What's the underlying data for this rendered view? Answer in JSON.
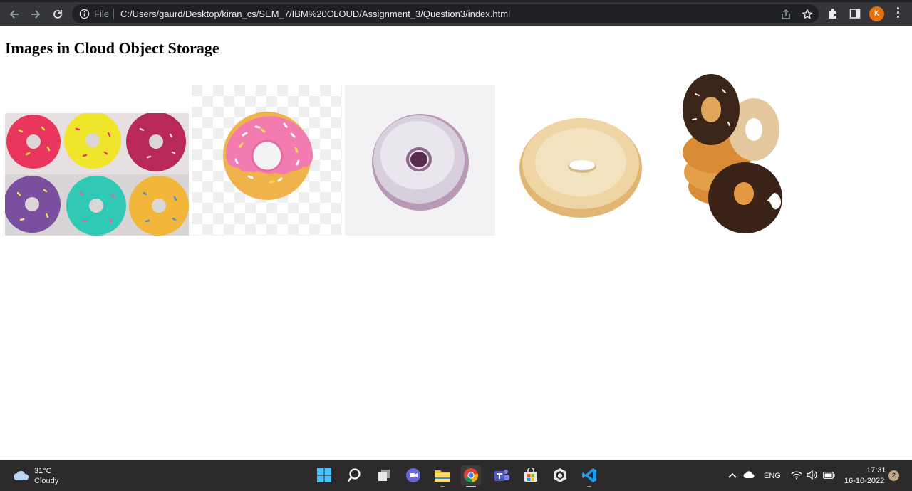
{
  "browser": {
    "file_label": "File",
    "url": "C:/Users/gaurd/Desktop/kiran_cs/SEM_7/IBM%20CLOUD/Assignment_3/Question3/index.html",
    "profile_initial": "K"
  },
  "page": {
    "title": "Images in Cloud Object Storage"
  },
  "taskbar": {
    "weather_temp": "31°C",
    "weather_condition": "Cloudy",
    "language": "ENG",
    "time": "17:31",
    "date": "16-10-2022",
    "notification_count": "2"
  }
}
